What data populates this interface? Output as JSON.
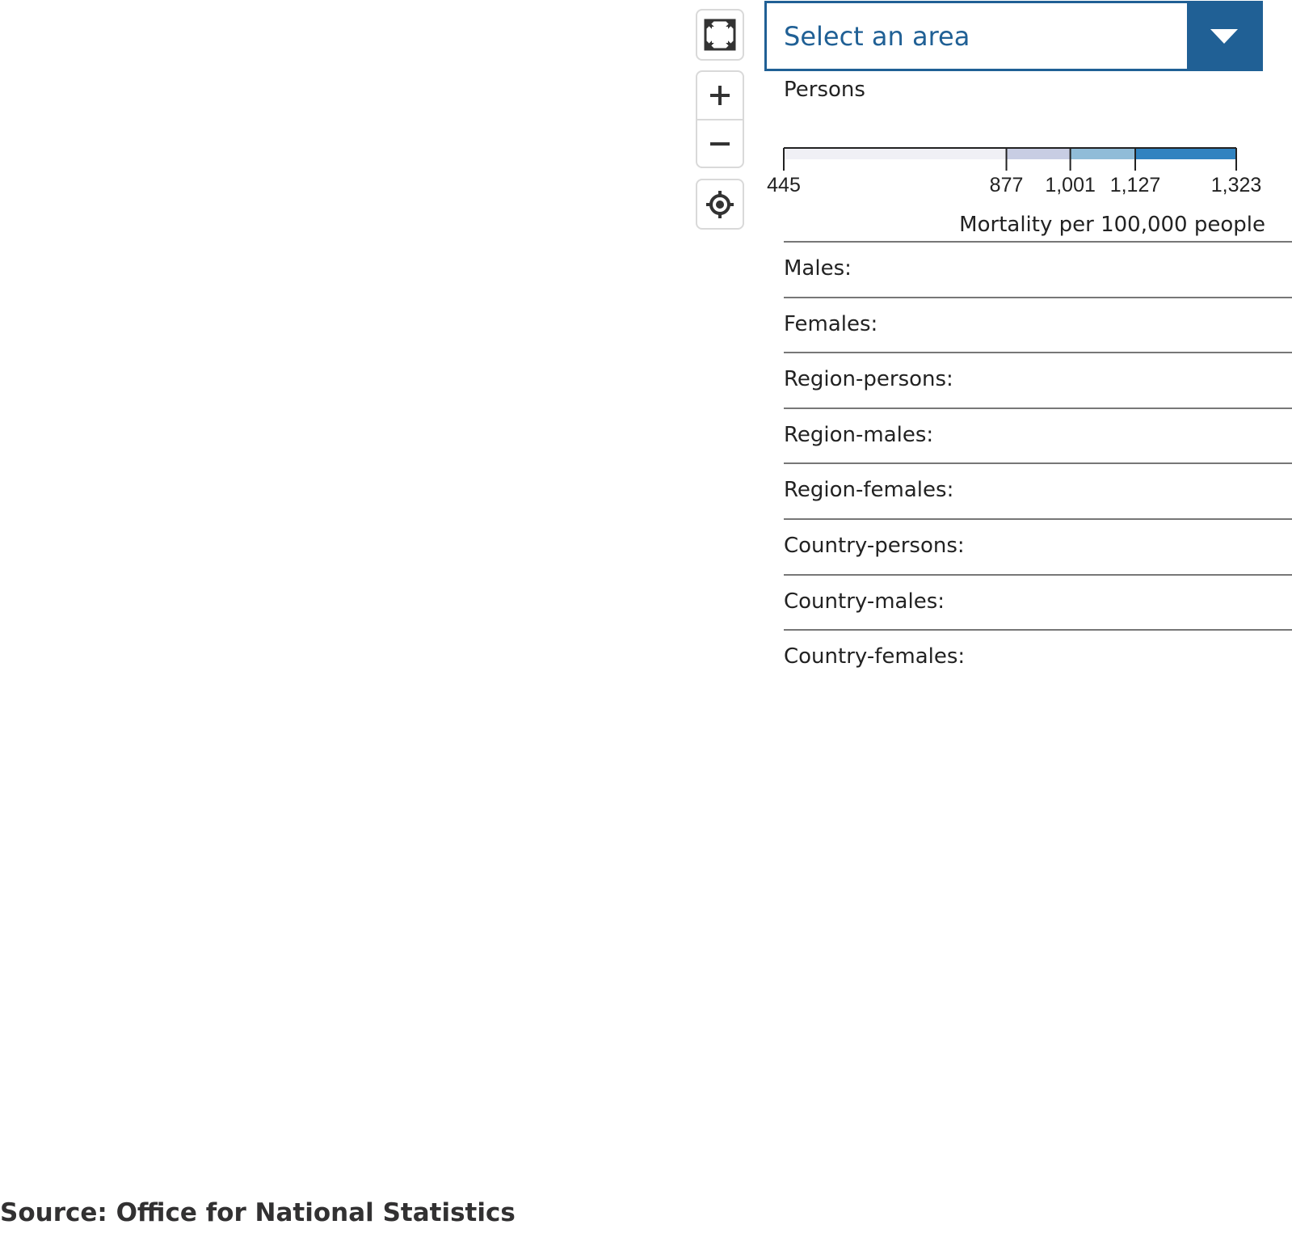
{
  "controls": {
    "fullscreen_icon": "fullscreen-icon",
    "zoom_in_icon": "plus-icon",
    "zoom_out_icon": "minus-icon",
    "locate_icon": "crosshair-icon"
  },
  "area_select": {
    "placeholder": "Select an area",
    "accent": "#206095"
  },
  "legend": {
    "title": "Persons",
    "unit": "Mortality per 100,000 people",
    "ticks": [
      "445",
      "877",
      "1,001",
      "1,127",
      "1,323"
    ],
    "breaks": [
      445,
      877,
      1001,
      1127,
      1323
    ],
    "colors": [
      "#f0f0f5",
      "#c8cde3",
      "#90bcd8",
      "#3183c0"
    ]
  },
  "info_rows": [
    {
      "label": "Males:"
    },
    {
      "label": "Females:"
    },
    {
      "label": "Region-persons:"
    },
    {
      "label": "Region-males:"
    },
    {
      "label": "Region-females:"
    },
    {
      "label": "Country-persons:"
    },
    {
      "label": "Country-males:"
    },
    {
      "label": "Country-females:"
    }
  ],
  "source": "Source: Office for National Statistics"
}
